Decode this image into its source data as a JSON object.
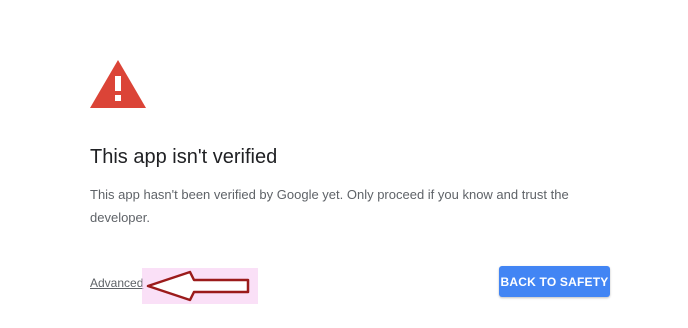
{
  "icons": {
    "warning": "warning-triangle-icon",
    "annotation": "left-arrow-annotation"
  },
  "colors": {
    "warning_red": "#db4437",
    "button_blue": "#4285f4",
    "title_text": "#202124",
    "body_text": "#5f6368",
    "annotation_arrow": "#9b1b1b",
    "annotation_highlight": "#f6c6f0"
  },
  "main": {
    "title": "This app isn't verified",
    "message": "This app hasn't been verified by Google yet. Only proceed if you know and trust the developer."
  },
  "footer": {
    "advanced_label": "Advanced",
    "back_button_label": "BACK TO SAFETY"
  }
}
